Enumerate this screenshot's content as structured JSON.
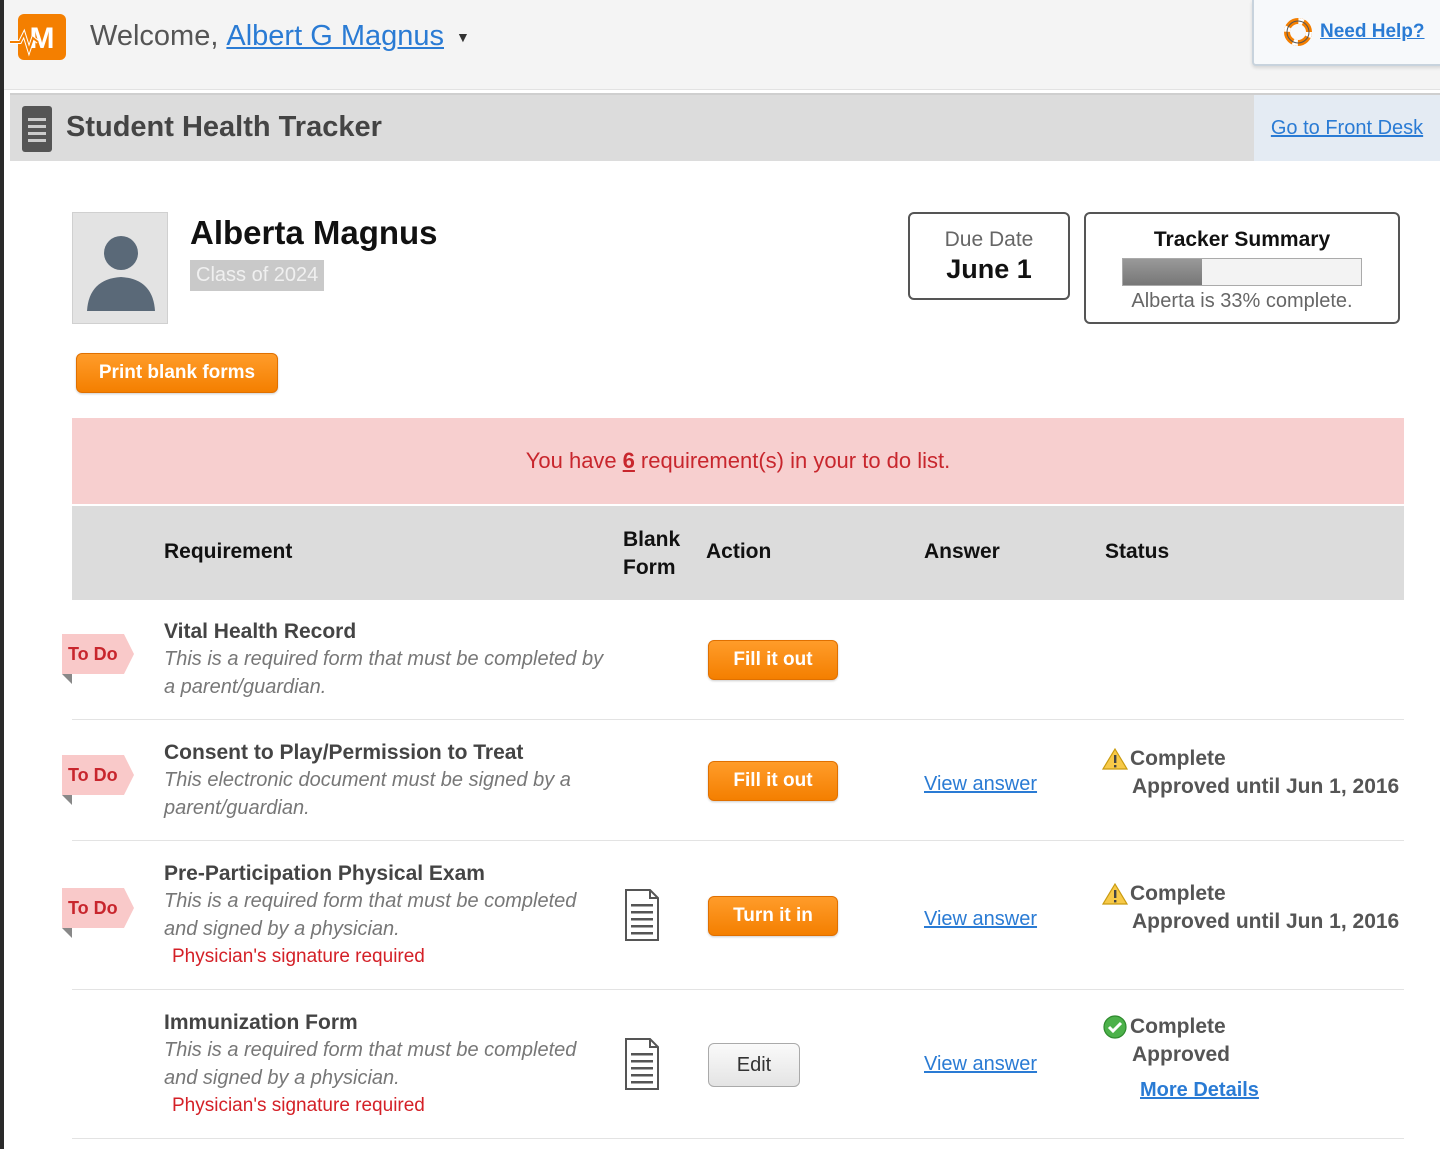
{
  "header": {
    "welcome_prefix": "Welcome,",
    "user_name": "Albert G Magnus",
    "help_label": "Need Help?",
    "brand_color": "#f47f00",
    "link_color": "#2a7bd4"
  },
  "titlebar": {
    "title": "Student Health Tracker",
    "front_desk_label": "Go to Front Desk"
  },
  "student": {
    "name": "Alberta Magnus",
    "class": "Class of 2024"
  },
  "due": {
    "label": "Due Date",
    "value": "June 1"
  },
  "summary": {
    "label": "Tracker Summary",
    "percent": 33,
    "text": "Alberta is 33% complete."
  },
  "print_button": "Print blank forms",
  "alert": {
    "prefix": "You have",
    "count": "6",
    "suffix": "requirement(s) in your to do list.",
    "color": "#c8262d"
  },
  "table": {
    "headers": {
      "requirement": "Requirement",
      "blank_form_1": "Blank",
      "blank_form_2": "Form",
      "action": "Action",
      "answer": "Answer",
      "status": "Status"
    },
    "rows": [
      {
        "tag": "To Do",
        "title": "Vital Health Record",
        "desc": "This is a required form that must be completed by a parent/guardian.",
        "action": "Fill it out"
      },
      {
        "tag": "To Do",
        "title": "Consent to Play/Permission to Treat",
        "desc": "This electronic document must be signed by a parent/guardian.",
        "action": "Fill it out",
        "answer": "View answer",
        "status_line1": "Complete",
        "status_line2": "Approved until Jun 1, 2016",
        "status_icon": "warning-icon"
      },
      {
        "tag": "To Do",
        "title": "Pre-Participation Physical Exam",
        "desc": "This is a required form that must be completed and signed by a physician.",
        "sig": "Physician's signature required",
        "action": "Turn it in",
        "answer": "View answer",
        "status_line1": "Complete",
        "status_line2": "Approved until Jun 1, 2016",
        "status_icon": "warning-icon"
      },
      {
        "title": "Immunization Form",
        "desc": "This is a required form that must be completed and signed by a physician.",
        "sig": "Physician's signature required",
        "action": "Edit",
        "answer": "View answer",
        "status_line1": "Complete",
        "status_line2": "Approved",
        "more_details": "More Details",
        "status_icon": "check-circle-icon"
      }
    ]
  }
}
